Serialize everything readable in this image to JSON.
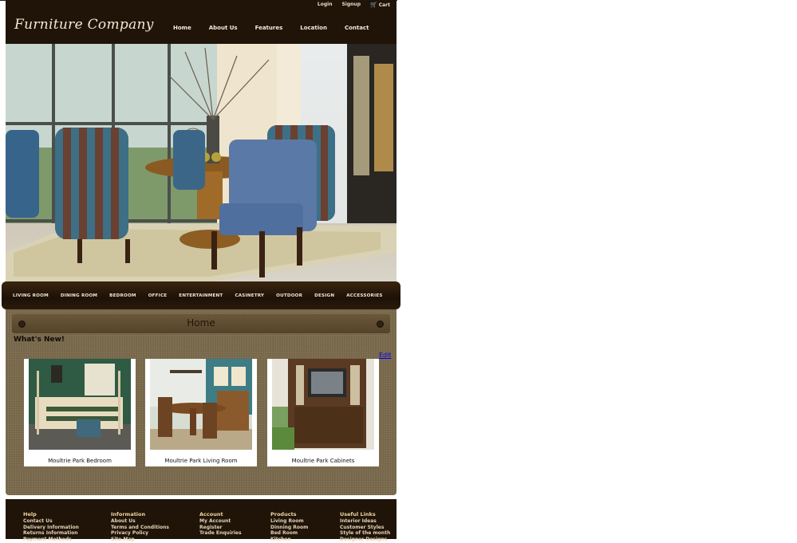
{
  "header": {
    "top_links": [
      "Login",
      "Signup",
      "Cart"
    ],
    "logo": "Furniture Company",
    "nav": [
      "Home",
      "About Us",
      "Features",
      "Location",
      "Contact"
    ]
  },
  "categories": [
    "LIVING ROOM",
    "DINING ROOM",
    "BEDROOM",
    "OFFICE",
    "ENTERTAINMENT",
    "CASINETRY",
    "OUTDOOR",
    "DESIGN",
    "ACCESSORIES"
  ],
  "content": {
    "title": "Home",
    "heading": "What's New!",
    "edit": "Edit",
    "products": [
      {
        "caption": "Moultrie Park Bedroom"
      },
      {
        "caption": "Moultrie Park Living Room"
      },
      {
        "caption": "Moultrie Park Cabinets"
      }
    ]
  },
  "footer": {
    "columns": [
      {
        "title": "Help",
        "links": [
          "Contact Us",
          "Delivery Information",
          "Returns Information",
          "Payment Methods"
        ]
      },
      {
        "title": "Information",
        "links": [
          "About Us",
          "Terms and Conditions",
          "Privacy Policy",
          "Site Map"
        ]
      },
      {
        "title": "Account",
        "links": [
          "My Account",
          "Register",
          "Trade Enquiries"
        ]
      },
      {
        "title": "Products",
        "links": [
          "Living Room",
          "Dinning Room",
          "Bed Room",
          "Kitchen"
        ]
      },
      {
        "title": "Useful Links",
        "links": [
          "Interior Ideas",
          "Customer Styles",
          "Style of the month",
          "Designer Designs"
        ]
      }
    ]
  },
  "colors": {
    "dark_brown": "#201409",
    "panel_brown": "#7a6a4d",
    "link_blue": "#0000ee"
  },
  "icons": [
    "cart-icon"
  ]
}
